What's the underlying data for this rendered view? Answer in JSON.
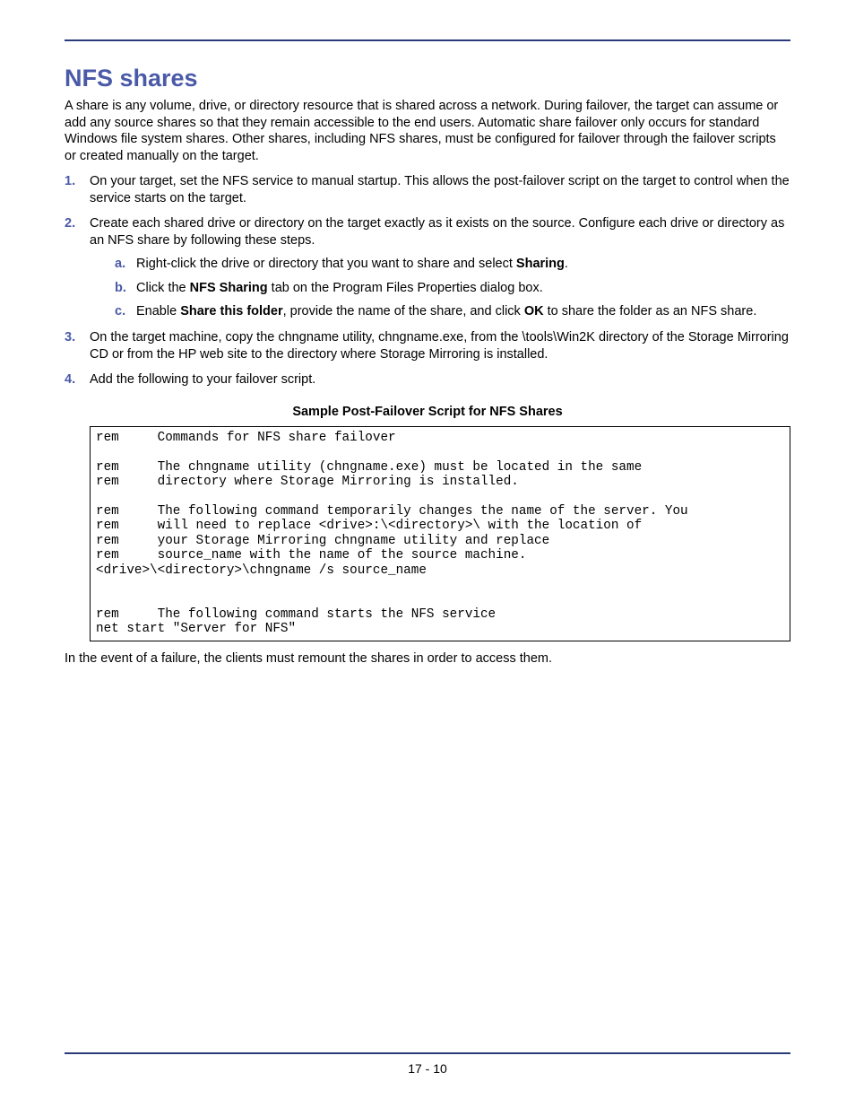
{
  "heading": "NFS shares",
  "intro": "A share is any volume, drive, or directory resource that is shared across a network. During failover, the target can assume or add any source shares so that they remain accessible to the end users. Automatic share failover only occurs for standard Windows file system shares. Other shares, including NFS shares, must be configured for failover through the failover scripts or created manually on the target.",
  "steps": {
    "s1": "On your target, set the NFS service to manual startup. This allows the post-failover script on the target to control when the service starts on the target.",
    "s2": "Create each shared drive or directory on the target exactly as it exists on the source. Configure each drive or directory as an NFS share by following these steps.",
    "s2a_pre": "Right-click the drive or directory that you want to share and select ",
    "s2a_bold": "Sharing",
    "s2a_post": ".",
    "s2b_pre": "Click the ",
    "s2b_bold": "NFS Sharing",
    "s2b_post": " tab on the Program Files Properties dialog box.",
    "s2c_pre": "Enable ",
    "s2c_bold1": "Share this folder",
    "s2c_mid": ", provide the name of the share, and click ",
    "s2c_bold2": "OK",
    "s2c_post": " to share the folder as an NFS share.",
    "s3": "On the target machine, copy the chngname utility, chngname.exe, from the \\tools\\Win2K directory of the Storage Mirroring CD or from the HP web site to the directory where Storage Mirroring is installed.",
    "s4": "Add the following to your failover script."
  },
  "nums": {
    "n1": "1.",
    "n2": "2.",
    "n3": "3.",
    "n4": "4.",
    "a": "a.",
    "b": "b.",
    "c": "c."
  },
  "script_title": "Sample Post-Failover Script for NFS Shares",
  "code": "rem     Commands for NFS share failover\n\nrem     The chngname utility (chngname.exe) must be located in the same\nrem     directory where Storage Mirroring is installed.\n\nrem     The following command temporarily changes the name of the server. You\nrem     will need to replace <drive>:\\<directory>\\ with the location of\nrem     your Storage Mirroring chngname utility and replace\nrem     source_name with the name of the source machine.\n<drive>\\<directory>\\chngname /s source_name\n\n\nrem     The following command starts the NFS service\nnet start \"Server for NFS\"",
  "after": "In the event of a failure, the clients must remount the shares in order to access them.",
  "page_number": "17 - 10"
}
